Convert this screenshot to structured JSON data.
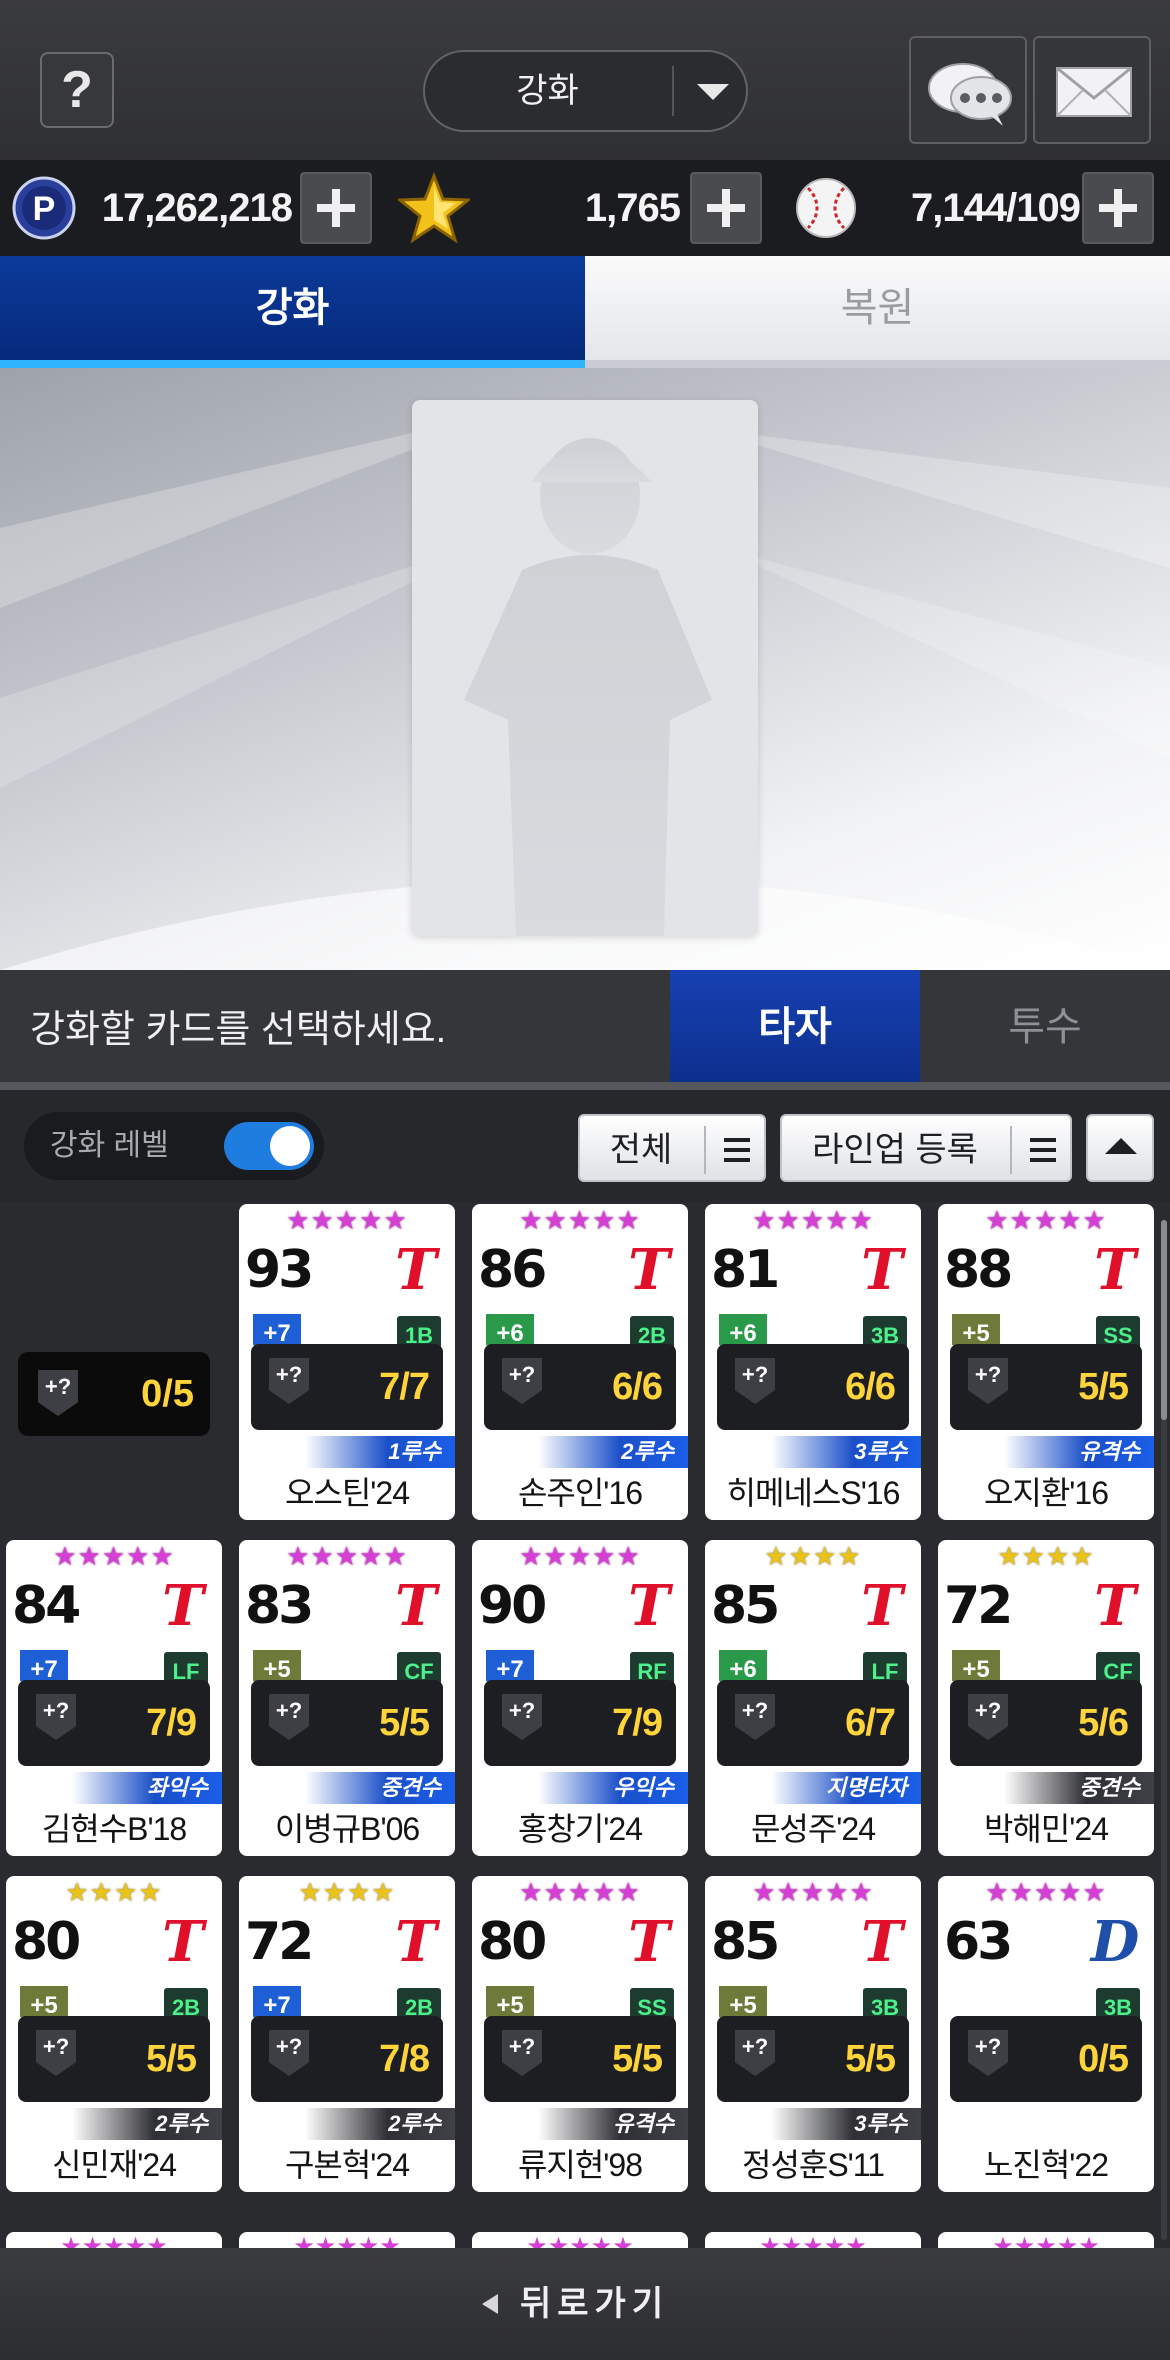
{
  "header": {
    "help_label": "?",
    "mode_select": {
      "value": "강화"
    },
    "chat_icon": "chat-bubbles-icon",
    "mail_icon": "envelope-icon"
  },
  "currency": {
    "points": {
      "icon": "p-coin-icon",
      "value": "17,262,218"
    },
    "stars": {
      "icon": "gold-star-icon",
      "value": "1,765"
    },
    "balls": {
      "icon": "baseball-icon",
      "value": "7,144/109"
    }
  },
  "main_tabs": [
    {
      "label": "강화",
      "active": true
    },
    {
      "label": "복원",
      "active": false
    }
  ],
  "preview": {
    "placeholder": "player-silhouette"
  },
  "select_bar": {
    "prompt": "강화할 카드를 선택하세요.",
    "tabs": [
      {
        "label": "타자",
        "active": true
      },
      {
        "label": "투수",
        "active": false
      }
    ]
  },
  "filters": {
    "toggle_label": "강화 레벨",
    "toggle_on": true,
    "filter_all": "전체",
    "filter_lineup": "라인업 등록"
  },
  "level_summary": {
    "value": "0/5",
    "icon_text": "+?"
  },
  "cards": [
    {
      "stars": "★★★★★",
      "star_color": "pink",
      "ovr": "93",
      "team": "T",
      "team_color": "#e0102a",
      "enh": "+7",
      "enh_color": "#1f5fd6",
      "pos": "1B",
      "level": "7/7",
      "role": "1루수",
      "role_style": "blue",
      "name": "오스틴'24"
    },
    {
      "stars": "★★★★★",
      "star_color": "pink",
      "ovr": "86",
      "team": "T",
      "team_color": "#e0102a",
      "enh": "+6",
      "enh_color": "#2a9a4a",
      "pos": "2B",
      "level": "6/6",
      "role": "2루수",
      "role_style": "blue",
      "name": "손주인'16"
    },
    {
      "stars": "★★★★★",
      "star_color": "pink",
      "ovr": "81",
      "team": "T",
      "team_color": "#e0102a",
      "enh": "+6",
      "enh_color": "#2a9a4a",
      "pos": "3B",
      "level": "6/6",
      "role": "3루수",
      "role_style": "blue",
      "name": "히메네스S'16"
    },
    {
      "stars": "★★★★★",
      "star_color": "pink",
      "ovr": "88",
      "team": "T",
      "team_color": "#e0102a",
      "enh": "+5",
      "enh_color": "#6d7a3a",
      "pos": "SS",
      "level": "5/5",
      "role": "유격수",
      "role_style": "blue",
      "name": "오지환'16"
    },
    {
      "stars": "★★★★★",
      "star_color": "pink",
      "ovr": "84",
      "team": "T",
      "team_color": "#e0102a",
      "enh": "+7",
      "enh_color": "#1f5fd6",
      "pos": "LF",
      "level": "7/9",
      "role": "좌익수",
      "role_style": "blue",
      "name": "김현수B'18"
    },
    {
      "stars": "★★★★★",
      "star_color": "pink",
      "ovr": "83",
      "team": "T",
      "team_color": "#e0102a",
      "enh": "+5",
      "enh_color": "#6d7a3a",
      "pos": "CF",
      "level": "5/5",
      "role": "중견수",
      "role_style": "blue",
      "name": "이병규B'06"
    },
    {
      "stars": "★★★★★",
      "star_color": "pink",
      "ovr": "90",
      "team": "T",
      "team_color": "#e0102a",
      "enh": "+7",
      "enh_color": "#1f5fd6",
      "pos": "RF",
      "level": "7/9",
      "role": "우익수",
      "role_style": "blue",
      "name": "홍창기'24"
    },
    {
      "stars": "★★★★",
      "star_color": "gold",
      "ovr": "85",
      "team": "T",
      "team_color": "#e0102a",
      "enh": "+6",
      "enh_color": "#2a9a4a",
      "pos": "LF",
      "level": "6/7",
      "role": "지명타자",
      "role_style": "blue",
      "name": "문성주'24"
    },
    {
      "stars": "★★★★",
      "star_color": "gold",
      "ovr": "72",
      "team": "T",
      "team_color": "#e0102a",
      "enh": "+5",
      "enh_color": "#6d7a3a",
      "pos": "CF",
      "level": "5/6",
      "role": "중견수",
      "role_style": "dark",
      "name": "박해민'24"
    },
    {
      "stars": "★★★★",
      "star_color": "gold",
      "ovr": "80",
      "team": "T",
      "team_color": "#e0102a",
      "enh": "+5",
      "enh_color": "#6d7a3a",
      "pos": "2B",
      "level": "5/5",
      "role": "2루수",
      "role_style": "dark",
      "name": "신민재'24"
    },
    {
      "stars": "★★★★",
      "star_color": "gold",
      "ovr": "72",
      "team": "T",
      "team_color": "#e0102a",
      "enh": "+7",
      "enh_color": "#1f5fd6",
      "pos": "2B",
      "level": "7/8",
      "role": "2루수",
      "role_style": "dark",
      "name": "구본혁'24"
    },
    {
      "stars": "★★★★★",
      "star_color": "pink",
      "ovr": "80",
      "team": "T",
      "team_color": "#e0102a",
      "enh": "+5",
      "enh_color": "#6d7a3a",
      "pos": "SS",
      "level": "5/5",
      "role": "유격수",
      "role_style": "dark",
      "name": "류지현'98"
    },
    {
      "stars": "★★★★★",
      "star_color": "pink",
      "ovr": "85",
      "team": "T",
      "team_color": "#e0102a",
      "enh": "+5",
      "enh_color": "#6d7a3a",
      "pos": "3B",
      "level": "5/5",
      "role": "3루수",
      "role_style": "dark",
      "name": "정성훈S'11"
    },
    {
      "stars": "★★★★★",
      "star_color": "pink",
      "ovr": "63",
      "team": "D",
      "team_color": "#1f4fa8",
      "enh": "",
      "enh_color": "",
      "pos": "3B",
      "level": "0/5",
      "role": "",
      "role_style": "none",
      "name": "노진혁'22"
    }
  ],
  "partial_row_stars": "★★★★★",
  "footer": {
    "back_label": "뒤로가기"
  },
  "colors": {
    "accent_blue": "#0b3a9a",
    "tab_highlight": "#2fb4ff",
    "level_yellow": "#ffd43b",
    "pink_star": "#d63fd6"
  }
}
